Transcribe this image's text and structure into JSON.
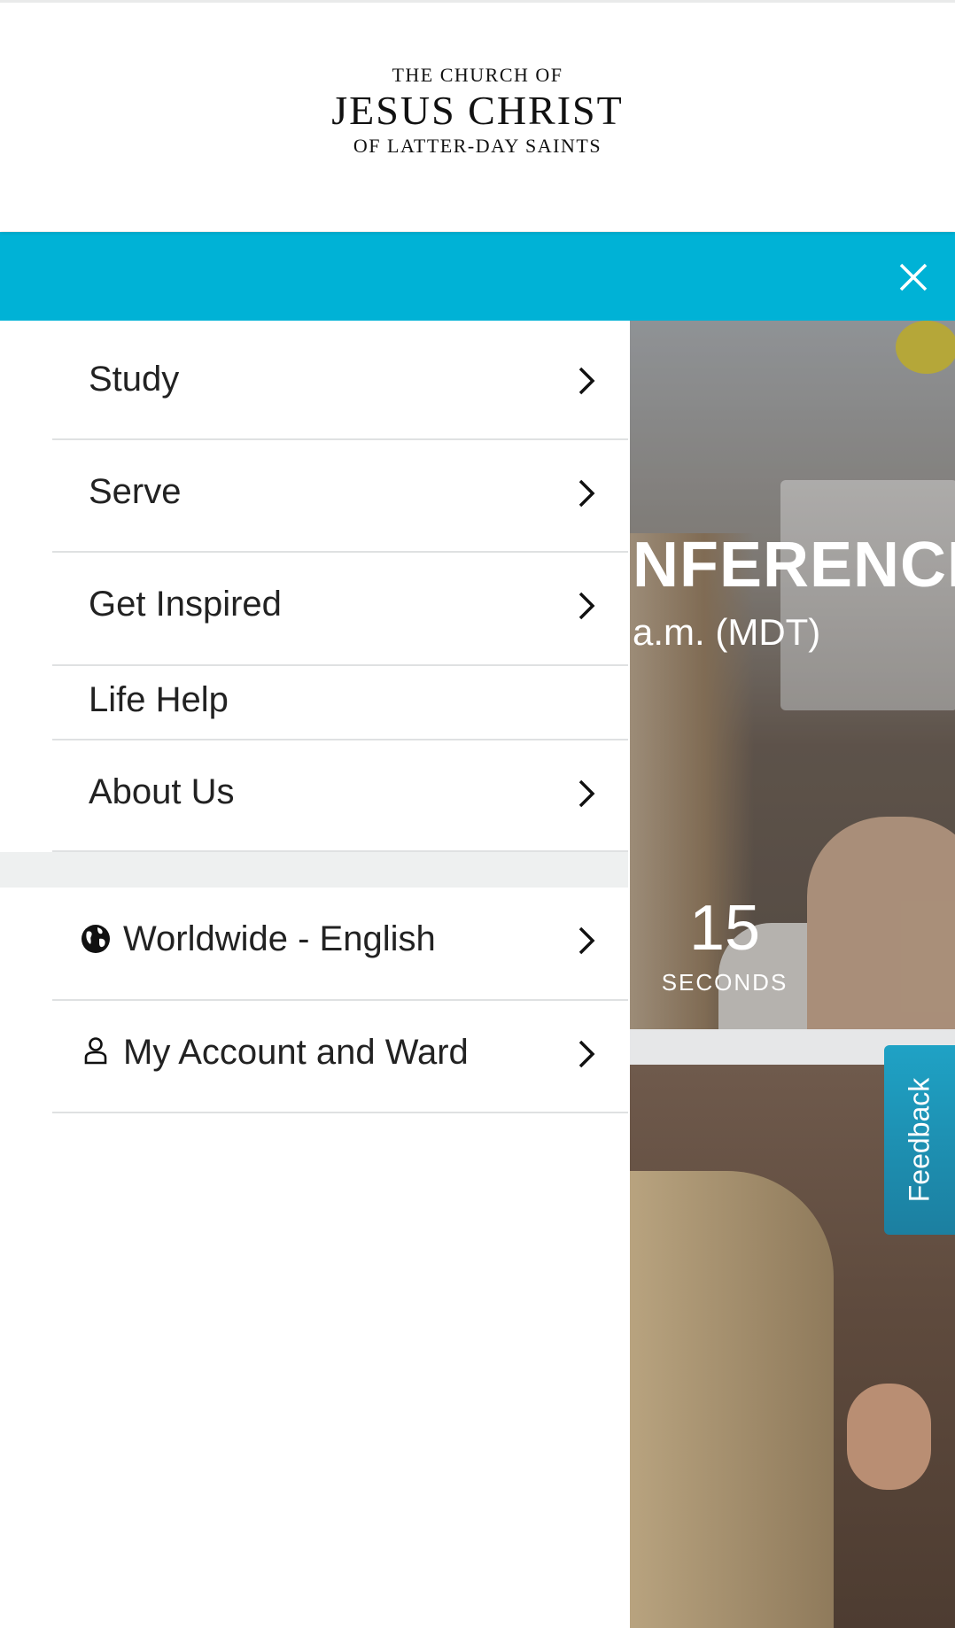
{
  "logo": {
    "line1": "THE CHURCH OF",
    "line2": "JESUS CHRIST",
    "line3": "OF LATTER-DAY SAINTS"
  },
  "colors": {
    "accent": "#00b2d6",
    "feedback": "#1c8fb3"
  },
  "menu": {
    "close_icon": "close-icon",
    "items": [
      {
        "label": "Study",
        "has_chevron": true
      },
      {
        "label": "Serve",
        "has_chevron": true
      },
      {
        "label": "Get Inspired",
        "has_chevron": true
      },
      {
        "label": "Life Help",
        "has_chevron": false
      },
      {
        "label": "About Us",
        "has_chevron": true
      }
    ],
    "secondary": [
      {
        "label": "Worldwide - English",
        "icon": "globe-icon"
      },
      {
        "label": "My Account and Ward",
        "icon": "user-icon"
      }
    ]
  },
  "hero": {
    "title_partial": "NFERENCE",
    "time_partial": "a.m. (MDT)",
    "countdown_value": "15",
    "countdown_label": "SECONDS"
  },
  "feedback": {
    "label": "Feedback"
  }
}
